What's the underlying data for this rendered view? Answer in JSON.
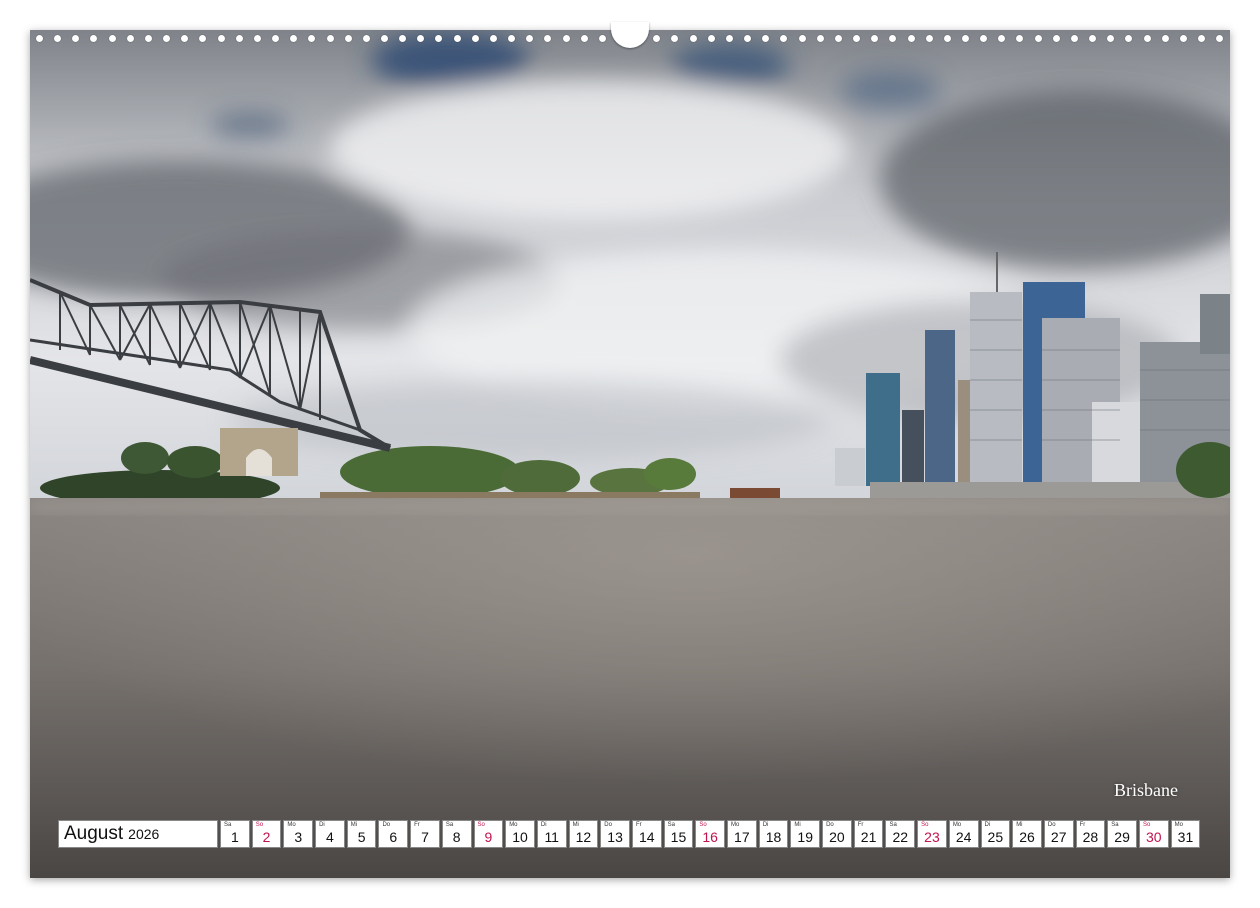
{
  "photo": {
    "caption": "Brisbane",
    "colors": {
      "sky_top": "#8a8d92",
      "cloud": "#e8e9ec",
      "blue_patch": "#2f4a73",
      "water_top": "#7e7a77",
      "water_bottom": "#4f4b49",
      "trees": "#3f5a31",
      "bridge": "#3a3d42"
    }
  },
  "calendar": {
    "month": "August",
    "year": "2026",
    "sunday_color": "#c0134d",
    "days": [
      {
        "wd": "Sa",
        "d": "1",
        "sun": false
      },
      {
        "wd": "So",
        "d": "2",
        "sun": true
      },
      {
        "wd": "Mo",
        "d": "3",
        "sun": false
      },
      {
        "wd": "Di",
        "d": "4",
        "sun": false
      },
      {
        "wd": "Mi",
        "d": "5",
        "sun": false
      },
      {
        "wd": "Do",
        "d": "6",
        "sun": false
      },
      {
        "wd": "Fr",
        "d": "7",
        "sun": false
      },
      {
        "wd": "Sa",
        "d": "8",
        "sun": false
      },
      {
        "wd": "So",
        "d": "9",
        "sun": true
      },
      {
        "wd": "Mo",
        "d": "10",
        "sun": false
      },
      {
        "wd": "Di",
        "d": "11",
        "sun": false
      },
      {
        "wd": "Mi",
        "d": "12",
        "sun": false
      },
      {
        "wd": "Do",
        "d": "13",
        "sun": false
      },
      {
        "wd": "Fr",
        "d": "14",
        "sun": false
      },
      {
        "wd": "Sa",
        "d": "15",
        "sun": false
      },
      {
        "wd": "So",
        "d": "16",
        "sun": true
      },
      {
        "wd": "Mo",
        "d": "17",
        "sun": false
      },
      {
        "wd": "Di",
        "d": "18",
        "sun": false
      },
      {
        "wd": "Mi",
        "d": "19",
        "sun": false
      },
      {
        "wd": "Do",
        "d": "20",
        "sun": false
      },
      {
        "wd": "Fr",
        "d": "21",
        "sun": false
      },
      {
        "wd": "Sa",
        "d": "22",
        "sun": false
      },
      {
        "wd": "So",
        "d": "23",
        "sun": true
      },
      {
        "wd": "Mo",
        "d": "24",
        "sun": false
      },
      {
        "wd": "Di",
        "d": "25",
        "sun": false
      },
      {
        "wd": "Mi",
        "d": "26",
        "sun": false
      },
      {
        "wd": "Do",
        "d": "27",
        "sun": false
      },
      {
        "wd": "Fr",
        "d": "28",
        "sun": false
      },
      {
        "wd": "Sa",
        "d": "29",
        "sun": false
      },
      {
        "wd": "So",
        "d": "30",
        "sun": true
      },
      {
        "wd": "Mo",
        "d": "31",
        "sun": false
      }
    ]
  }
}
